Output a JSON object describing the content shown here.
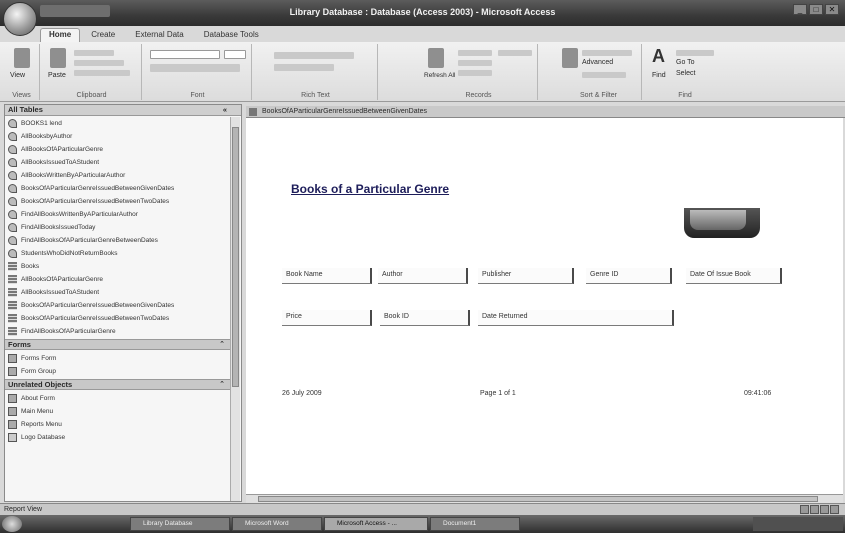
{
  "window": {
    "title": "Library Database : Database (Access 2003) - Microsoft Access",
    "controls": [
      "_",
      "□",
      "✕"
    ]
  },
  "ribbon": {
    "tabs": [
      "Home",
      "Create",
      "External Data",
      "Database Tools"
    ],
    "active_tab": "Home",
    "groups": [
      "Views",
      "Clipboard",
      "Font",
      "Rich Text",
      "Records",
      "Sort & Filter",
      "Find"
    ],
    "buttons": {
      "view": "View",
      "refresh": "Refresh All",
      "find": "Find",
      "paste": "Paste",
      "advanced": "Advanced",
      "go_to": "Go To",
      "select": "Select"
    }
  },
  "nav_pane": {
    "header": "All Tables",
    "items": [
      {
        "type": "query",
        "label": "BOOKS1 lend"
      },
      {
        "type": "query",
        "label": "AllBooksbyAuthor"
      },
      {
        "type": "query",
        "label": "AllBooksOfAParticularGenre"
      },
      {
        "type": "query",
        "label": "AllBooksIssuedToAStudent"
      },
      {
        "type": "query",
        "label": "AllBooksWrittenByAParticularAuthor"
      },
      {
        "type": "query",
        "label": "BooksOfAParticularGenreIssuedBetweenGivenDates"
      },
      {
        "type": "query",
        "label": "BooksOfAParticularGenreIssuedBetweenTwoDates"
      },
      {
        "type": "query",
        "label": "FindAllBooksWrittenByAParticularAuthor"
      },
      {
        "type": "query",
        "label": "FindAllBooksIssuedToday"
      },
      {
        "type": "query",
        "label": "FindAllBooksOfAParticularGenreBetweenDates"
      },
      {
        "type": "query",
        "label": "StudentsWhoDidNotReturnBooks"
      },
      {
        "type": "table",
        "label": "Books"
      },
      {
        "type": "report",
        "label": "AllBooksOfAParticularGenre"
      },
      {
        "type": "report",
        "label": "AllBooksIssuedToAStudent"
      },
      {
        "type": "report",
        "label": "BooksOfAParticularGenreIssuedBetweenGivenDates"
      },
      {
        "type": "report",
        "label": "BooksOfAParticularGenreIssuedBetweenTwoDates"
      },
      {
        "type": "report",
        "label": "FindAllBooksOfAParticularGenre"
      }
    ],
    "sections": [
      {
        "title": "Forms",
        "items": [
          "Forms Form",
          "Form Group"
        ]
      },
      {
        "title": "Unrelated Objects",
        "items": [
          "About Form",
          "Main Menu",
          "Reports Menu",
          "Logo Database"
        ]
      }
    ]
  },
  "document": {
    "tab_label": "BooksOfAParticularGenreIssuedBetweenGivenDates",
    "title": "Books of a Particular Genre",
    "fields_row1": [
      "Book Name",
      "Author",
      "Publisher",
      "Genre ID",
      "Date Of Issue Book"
    ],
    "fields_row2": [
      "Price",
      "Book ID",
      "Date Returned"
    ],
    "footer": {
      "date": "26 July 2009",
      "page": "Page 1 of 1",
      "time": "09:41:06"
    }
  },
  "status": {
    "text": "Report View"
  },
  "taskbar": {
    "buttons": [
      "Library Database",
      "Microsoft Word",
      "Microsoft Access - ...",
      "Document1"
    ]
  }
}
